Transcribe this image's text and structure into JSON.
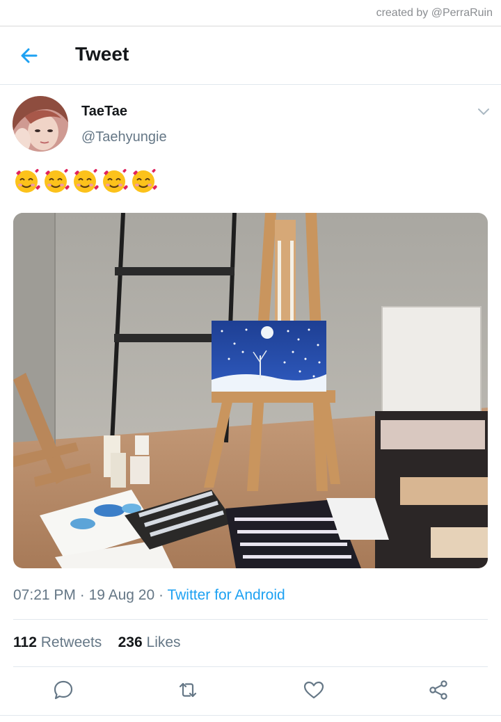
{
  "watermark": "created by @PerraRuin",
  "header": {
    "title": "Tweet",
    "back_icon": "arrow-left-icon"
  },
  "tweet": {
    "display_name": "TaeTae",
    "handle": "@Taehyungie",
    "text": "🥰🥰🥰🥰🥰",
    "time": "07:21 PM",
    "date": "19 Aug 20",
    "source": "Twitter for Android",
    "retweets": "112",
    "retweets_label": "Retweets",
    "likes": "236",
    "likes_label": "Likes"
  },
  "actions": [
    "reply-icon",
    "retweet-icon",
    "like-icon",
    "share-icon"
  ],
  "colors": {
    "accent": "#1da1f2",
    "text": "#14171a",
    "muted": "#657786"
  }
}
